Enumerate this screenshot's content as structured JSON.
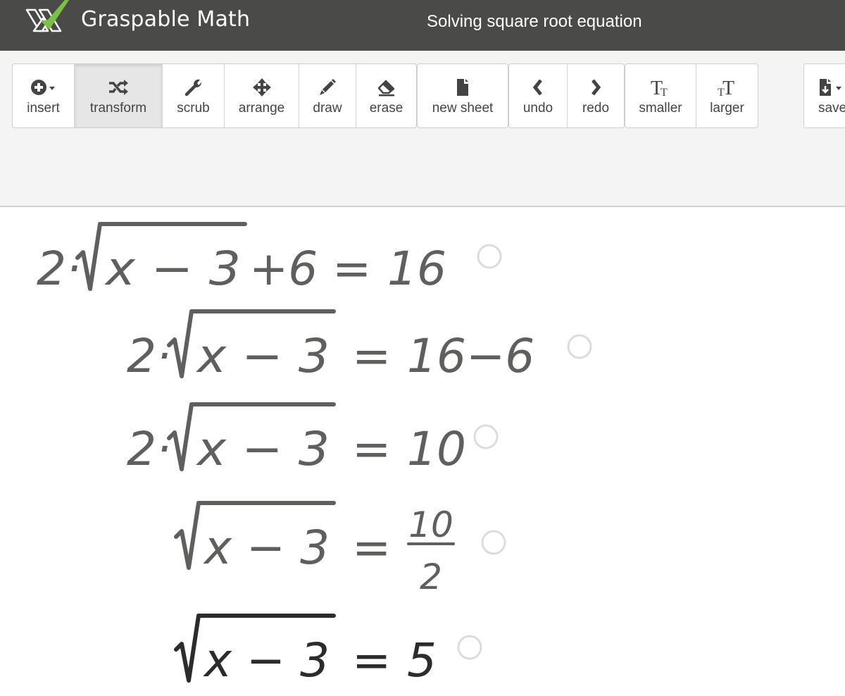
{
  "header": {
    "brand": "Graspable Math",
    "title": "Solving square root equation",
    "colors": {
      "bar": "#4a4a49",
      "logo_green": "#7bc142"
    }
  },
  "toolbar": {
    "buttons": [
      {
        "id": "insert",
        "label": "insert",
        "icon": "plus-circle-icon",
        "has_dropdown": true
      },
      {
        "id": "transform",
        "label": "transform",
        "icon": "shuffle-icon",
        "active": true
      },
      {
        "id": "scrub",
        "label": "scrub",
        "icon": "wrench-icon"
      },
      {
        "id": "arrange",
        "label": "arrange",
        "icon": "move-arrows-icon"
      },
      {
        "id": "draw",
        "label": "draw",
        "icon": "pencil-icon"
      },
      {
        "id": "erase",
        "label": "erase",
        "icon": "eraser-icon"
      },
      {
        "id": "new-sheet",
        "label": "new sheet",
        "icon": "file-icon"
      },
      {
        "id": "undo",
        "label": "undo",
        "icon": "chevron-left-icon"
      },
      {
        "id": "redo",
        "label": "redo",
        "icon": "chevron-right-icon"
      },
      {
        "id": "smaller",
        "label": "smaller",
        "icon": "text-smaller-icon"
      },
      {
        "id": "larger",
        "label": "larger",
        "icon": "text-larger-icon"
      },
      {
        "id": "save",
        "label": "save",
        "icon": "file-download-icon",
        "has_dropdown": true
      }
    ]
  },
  "equations": [
    {
      "coef": "2·",
      "radicand": [
        "x",
        "−",
        "3"
      ],
      "lhs_tail": "+6",
      "rhs": "16",
      "ink": "#5f5f5e"
    },
    {
      "coef": "2·",
      "radicand": [
        "x",
        "−",
        "3"
      ],
      "lhs_tail": "",
      "rhs": "16−6",
      "ink": "#5f5f5e"
    },
    {
      "coef": "2·",
      "radicand": [
        "x",
        "−",
        "3"
      ],
      "lhs_tail": "",
      "rhs": "10",
      "ink": "#5f5f5e"
    },
    {
      "coef": "",
      "radicand": [
        "x",
        "−",
        "3"
      ],
      "lhs_tail": "",
      "rhs_fraction": {
        "numerator": "10",
        "denominator": "2"
      },
      "ink": "#5f5f5e"
    },
    {
      "coef": "",
      "radicand": [
        "x",
        "−",
        "3"
      ],
      "lhs_tail": "",
      "rhs": "5",
      "ink": "#2c2c2c"
    }
  ],
  "equals_sign": "="
}
